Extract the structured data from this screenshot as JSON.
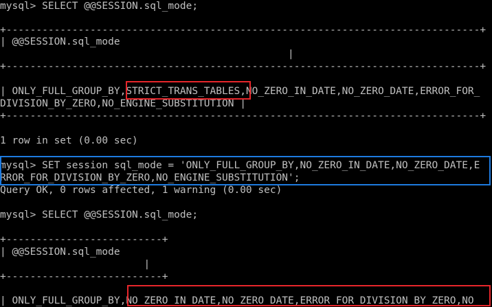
{
  "terminal": {
    "foreground": "#c0c0c0",
    "background": "#000000",
    "lines": [
      "mysql> SELECT @@SESSION.sql_mode;",
      "+-------------------------------------------------------------------------------+",
      "| @@SESSION.sql_mode",
      "                                                |",
      "+-------------------------------------------------------------------------------+",
      "| ONLY_FULL_GROUP_BY,STRICT_TRANS_TABLES,NO_ZERO_IN_DATE,NO_ZERO_DATE,ERROR_FOR_",
      "DIVISION_BY_ZERO,NO_ENGINE_SUBSTITUTION |",
      "+-------------------------------------------------------------------------------+",
      "1 row in set (0.00 sec)",
      "mysql> SET session sql_mode = 'ONLY_FULL_GROUP_BY,NO_ZERO_IN_DATE,NO_ZERO_DATE,E",
      "RROR_FOR_DIVISION_BY_ZERO,NO_ENGINE_SUBSTITUTION';",
      "Query OK, 0 rows affected, 1 warning (0.00 sec)",
      "mysql> SELECT @@SESSION.sql_mode;",
      "+--------------------------+",
      "| @@SESSION.sql_mode",
      "                        |",
      "+--------------------------+",
      "| ONLY_FULL_GROUP_BY,NO_ZERO_IN_DATE,NO_ZERO_DATE,ERROR_FOR_DIVISION_BY_ZERO,NO_"
    ]
  },
  "highlights": {
    "red_color": "#e8262b",
    "blue_color": "#1e7be0"
  }
}
